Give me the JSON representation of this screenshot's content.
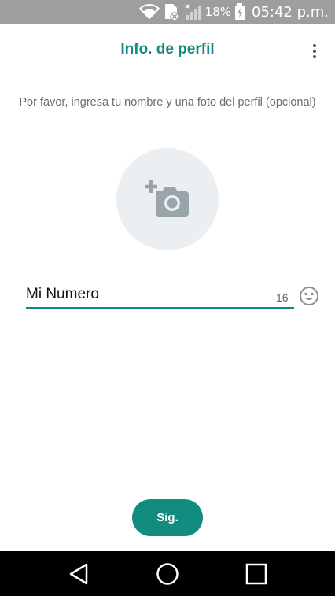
{
  "status_bar": {
    "icons": [
      "wifi-icon",
      "sim-card-icon",
      "signal-icon",
      "battery-icon"
    ],
    "battery_percent": "18%",
    "time": "05:42 p.m."
  },
  "header": {
    "title": "Info. de perfil",
    "menu_icon": "more-vert-icon"
  },
  "instructions": "Por favor, ingresa tu nombre y una foto del perfil (opcional)",
  "photo": {
    "icon": "add-photo-icon"
  },
  "name_field": {
    "value": "Mi Numero",
    "remaining_chars": "16",
    "emoji_icon": "emoji-icon"
  },
  "next_button": {
    "label": "Sig."
  },
  "nav_bar": {
    "icons": [
      "back-icon",
      "home-icon",
      "recents-icon"
    ]
  },
  "colors": {
    "accent": "#128c7e",
    "status_bar": "#9e9e9e",
    "photo_bg": "#eceff1",
    "icon_gray": "#9aa5ab"
  }
}
